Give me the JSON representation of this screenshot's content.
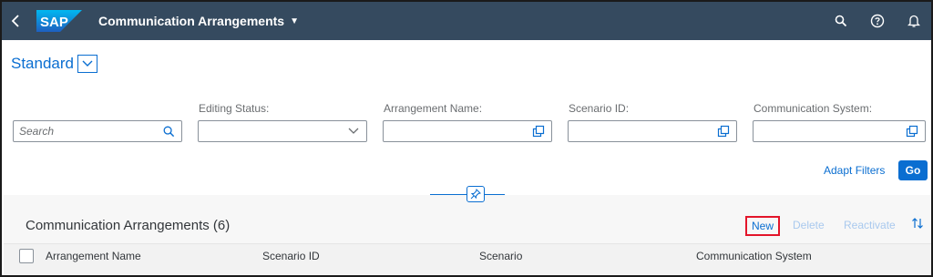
{
  "shell": {
    "logo_text": "SAP",
    "title": "Communication Arrangements",
    "icons": [
      "back-icon",
      "search-icon",
      "help-icon",
      "bell-icon"
    ]
  },
  "variant": {
    "title": "Standard"
  },
  "filters": {
    "search": {
      "placeholder": "Search"
    },
    "editing_status": {
      "label": "Editing Status:"
    },
    "arrangement_name": {
      "label": "Arrangement Name:"
    },
    "scenario_id": {
      "label": "Scenario ID:"
    },
    "communication_system": {
      "label": "Communication System:"
    },
    "adapt_label": "Adapt Filters",
    "go_label": "Go"
  },
  "table": {
    "title": "Communication Arrangements (6)",
    "toolbar": {
      "new": "New",
      "delete": "Delete",
      "reactivate": "Reactivate"
    },
    "columns": [
      "Arrangement Name",
      "Scenario ID",
      "Scenario",
      "Communication System"
    ]
  },
  "colors": {
    "shell": "#354a5f",
    "accent": "#0a6ed1",
    "highlight": "#e3152a"
  }
}
